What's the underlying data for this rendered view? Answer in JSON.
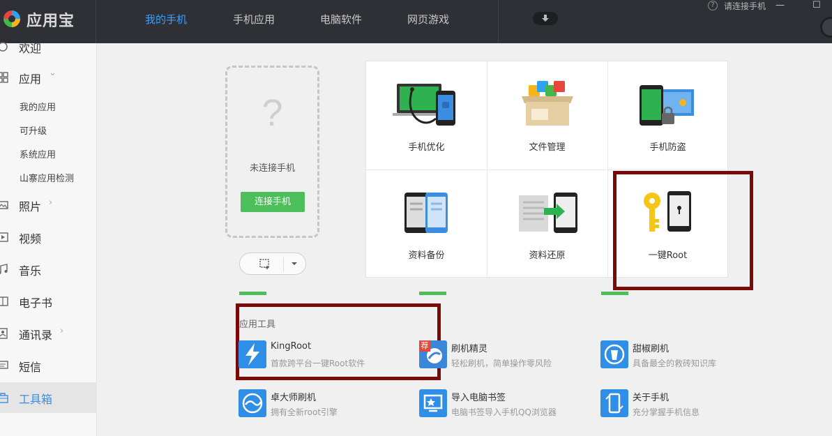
{
  "app": {
    "name": "应用宝"
  },
  "nav": {
    "tabs": [
      "我的手机",
      "手机应用",
      "电脑软件",
      "网页游戏"
    ]
  },
  "topbar": {
    "help": "?",
    "connect_label": "请连接手机",
    "minimize": "—",
    "maximize": "☐"
  },
  "sidebar": {
    "welcome": "欢迎",
    "apps": "应用",
    "apps_chevron": "⌄",
    "apps_sub": [
      "我的应用",
      "可升级",
      "系统应用",
      "山寨应用检测"
    ],
    "photos": "照片",
    "video": "视频",
    "music": "音乐",
    "ebook": "电子书",
    "contacts": "通讯录",
    "sms": "短信",
    "toolbox": "工具箱",
    "chevron": "›"
  },
  "phone": {
    "placeholder_icon": "?",
    "status": "未连接手机",
    "connect_button": "连接手机"
  },
  "grid": {
    "items": [
      "手机优化",
      "文件管理",
      "手机防盗",
      "资料备份",
      "资料还原",
      "一键Root"
    ]
  },
  "tools": {
    "title": "应用工具",
    "items": [
      {
        "name": "KingRoot",
        "desc": "首款跨平台一键Root软件"
      },
      {
        "name": "刷机精灵",
        "desc": "轻松刷机，简单操作零风险",
        "badge": "荐"
      },
      {
        "name": "甜椒刷机",
        "desc": "具备最全的救砖知识库"
      },
      {
        "name": "卓大师刷机",
        "desc": "拥有全新root引擎"
      },
      {
        "name": "导入电脑书签",
        "desc": "电脑书签导入手机QQ浏览器"
      },
      {
        "name": "关于手机",
        "desc": "充分掌握手机信息"
      }
    ]
  },
  "colors": {
    "accent": "#3aa0ff",
    "topbar": "#2e3036",
    "green": "#4cbf5b",
    "highlight": "#7a0a0a"
  }
}
